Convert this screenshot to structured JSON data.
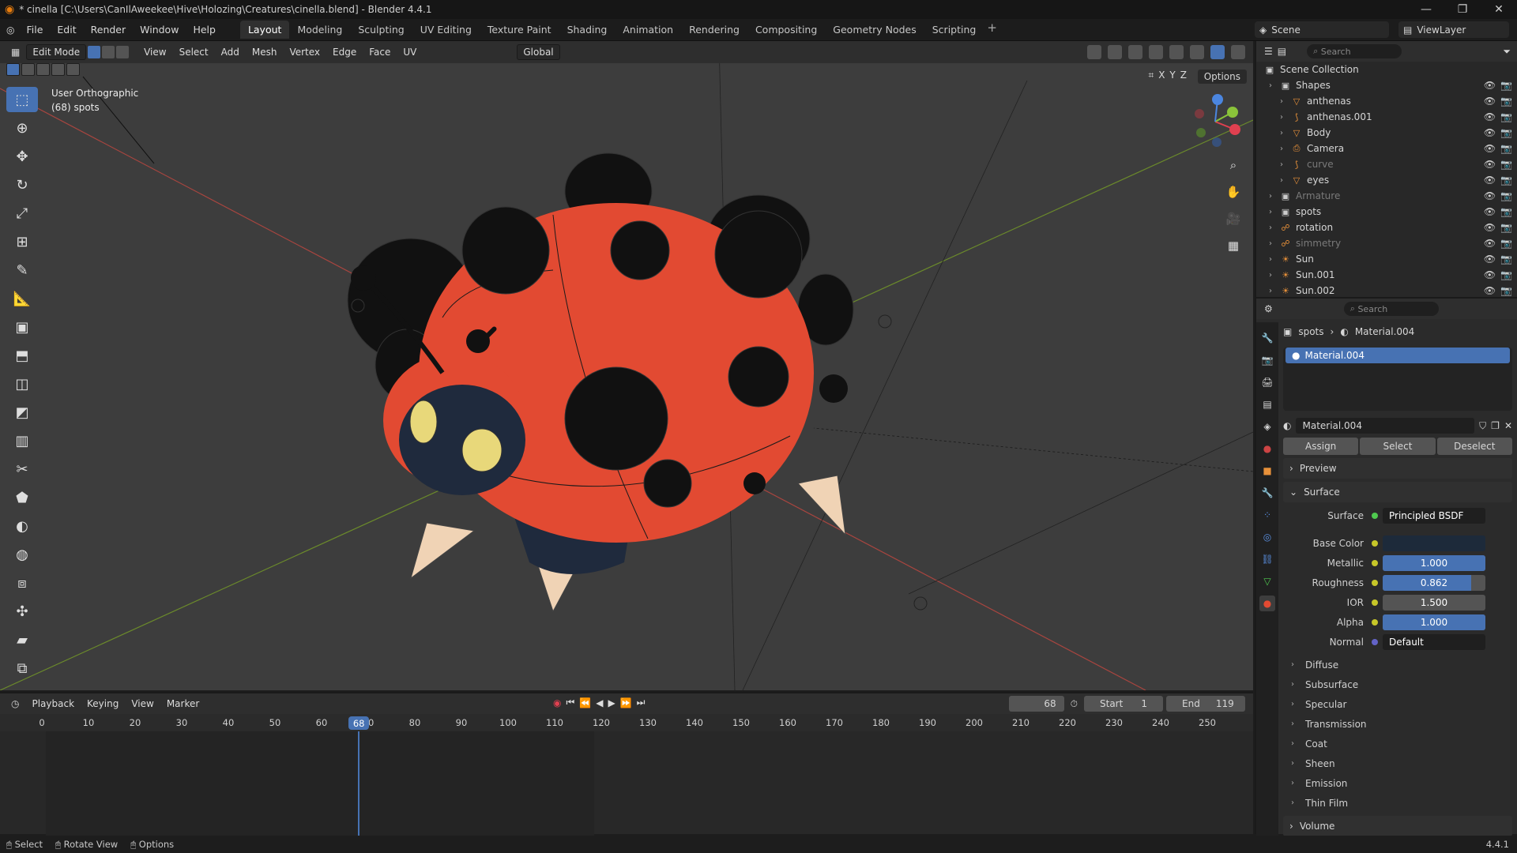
{
  "window": {
    "title": "* cinella [C:\\Users\\CanIlAweekee\\Hive\\Holozing\\Creatures\\cinella.blend] - Blender 4.4.1",
    "minimize": "—",
    "maximize": "❐",
    "close": "✕"
  },
  "menu": [
    "File",
    "Edit",
    "Render",
    "Window",
    "Help"
  ],
  "workspaces": [
    "Layout",
    "Modeling",
    "Sculpting",
    "UV Editing",
    "Texture Paint",
    "Shading",
    "Animation",
    "Rendering",
    "Compositing",
    "Geometry Nodes",
    "Scripting"
  ],
  "active_workspace": "Layout",
  "scene_name": "Scene",
  "view_layer": "ViewLayer",
  "viewport": {
    "mode": "Edit Mode",
    "menus": [
      "View",
      "Select",
      "Add",
      "Mesh",
      "Vertex",
      "Edge",
      "Face",
      "UV"
    ],
    "orientation": "Global",
    "options": "Options",
    "axis_x": "X",
    "axis_y": "Y",
    "axis_z": "Z",
    "overlay_line1": "User Orthographic",
    "overlay_line2": "(68) spots"
  },
  "outliner": {
    "search_placeholder": "Search",
    "collection": "Scene Collection",
    "rows": [
      {
        "name": "Shapes",
        "kind": "collection",
        "dim": false
      },
      {
        "name": "anthenas",
        "kind": "mesh",
        "dim": false
      },
      {
        "name": "anthenas.001",
        "kind": "curve",
        "dim": false
      },
      {
        "name": "Body",
        "kind": "mesh",
        "dim": false
      },
      {
        "name": "Camera",
        "kind": "camera",
        "dim": false
      },
      {
        "name": "curve",
        "kind": "curve",
        "dim": true
      },
      {
        "name": "eyes",
        "kind": "mesh",
        "dim": false
      },
      {
        "name": "Armature",
        "kind": "collection",
        "dim": true
      },
      {
        "name": "spots",
        "kind": "collection",
        "dim": false
      },
      {
        "name": "rotation",
        "kind": "armature",
        "dim": false
      },
      {
        "name": "simmetry",
        "kind": "armature",
        "dim": true
      },
      {
        "name": "Sun",
        "kind": "light",
        "dim": false
      },
      {
        "name": "Sun.001",
        "kind": "light",
        "dim": false
      },
      {
        "name": "Sun.002",
        "kind": "light",
        "dim": false
      }
    ]
  },
  "properties": {
    "search_placeholder": "Search",
    "object": "spots",
    "material": "Material.004",
    "slot": "Material.004",
    "buttons": [
      "Assign",
      "Select",
      "Deselect"
    ],
    "preview": "Preview",
    "surface_panel": "Surface",
    "surface_label": "Surface",
    "surface_value": "Principled BSDF",
    "params": [
      {
        "label": "Base Color",
        "value": "",
        "fill": 0
      },
      {
        "label": "Metallic",
        "value": "1.000",
        "fill": 1.0
      },
      {
        "label": "Roughness",
        "value": "0.862",
        "fill": 0.862
      },
      {
        "label": "IOR",
        "value": "1.500",
        "fill": 0
      },
      {
        "label": "Alpha",
        "value": "1.000",
        "fill": 1.0
      }
    ],
    "normal_label": "Normal",
    "normal_value": "Default",
    "subpanels": [
      "Diffuse",
      "Subsurface",
      "Specular",
      "Transmission",
      "Coat",
      "Sheen",
      "Emission",
      "Thin Film"
    ],
    "volume": "Volume"
  },
  "timeline": {
    "menus": [
      "Playback",
      "Keying",
      "View",
      "Marker"
    ],
    "current_frame": "68",
    "start_label": "Start",
    "start": "1",
    "end_label": "End",
    "end": "119",
    "ticks": [
      "0",
      "10",
      "20",
      "30",
      "40",
      "50",
      "60",
      "70",
      "80",
      "90",
      "100",
      "110",
      "120",
      "130",
      "140",
      "150",
      "160",
      "170",
      "180",
      "190",
      "200",
      "210",
      "220",
      "230",
      "240",
      "250"
    ]
  },
  "status": [
    "Select",
    "Rotate View",
    "Options"
  ],
  "version": "4.4.1",
  "colors": {
    "accent": "#4772b3",
    "body": "#e24a32",
    "spot": "#1a1a1a",
    "viewport": "#3d3d3d"
  }
}
